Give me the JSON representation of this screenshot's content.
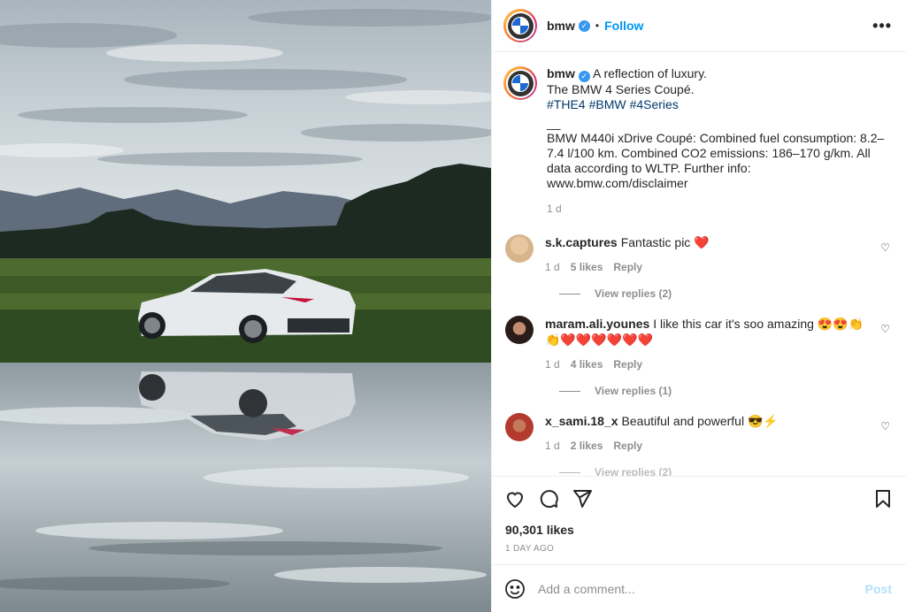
{
  "colors": {
    "link": "#0095f6",
    "hashtag": "#00376b",
    "muted": "#8e8e8e",
    "verified": "#3897f0"
  },
  "header": {
    "username": "bmw",
    "separator": "•",
    "follow_label": "Follow",
    "more_icon": "more-horizontal-icon"
  },
  "caption": {
    "username": "bmw",
    "line1": "A reflection of luxury.",
    "line2": "The BMW 4 Series Coupé.",
    "hashtags": [
      "#THE4",
      "#BMW",
      "#4Series"
    ],
    "dash": "__",
    "body": "BMW M440i xDrive Coupé: Combined fuel consumption: 8.2–7.4 l/100 km. Combined CO2 emissions: 186–170 g/km. All data according to WLTP. Further info: www.bmw.com/disclaimer",
    "time": "1 d"
  },
  "comments": [
    {
      "username": "s.k.captures",
      "text": "Fantastic pic ❤️",
      "time": "1 d",
      "likes": "5 likes",
      "reply": "Reply",
      "view_replies": "View replies (2)"
    },
    {
      "username": "maram.ali.younes",
      "text": "I like this car it's soo amazing 😍😍👏👏❤️❤️❤️❤️❤️❤️",
      "time": "1 d",
      "likes": "4 likes",
      "reply": "Reply",
      "view_replies": "View replies (1)"
    },
    {
      "username": "x_sami.18_x",
      "text": "Beautiful and powerful 😎⚡",
      "time": "1 d",
      "likes": "2 likes",
      "reply": "Reply",
      "view_replies": "View replies (2)"
    }
  ],
  "actions": {
    "like_icon": "heart-icon",
    "comment_icon": "comment-icon",
    "share_icon": "paper-plane-icon",
    "save_icon": "bookmark-icon"
  },
  "likes": "90,301 likes",
  "posted": "1 DAY AGO",
  "add_comment": {
    "placeholder": "Add a comment...",
    "post_label": "Post",
    "emoji_icon": "smiley-icon"
  }
}
